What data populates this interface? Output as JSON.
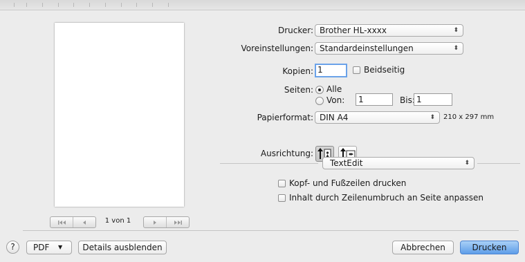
{
  "printer": {
    "label": "Drucker:",
    "value": "Brother HL-xxxx"
  },
  "presets": {
    "label": "Voreinstellungen:",
    "value": "Standardeinstellungen"
  },
  "copies": {
    "label": "Kopien:",
    "value": "1",
    "duplex_label": "Beidseitig",
    "duplex_checked": false
  },
  "pages": {
    "label": "Seiten:",
    "all_label": "Alle",
    "from_label": "Von:",
    "from_value": "1",
    "to_label": "Bis:",
    "to_value": "1",
    "selected": "all"
  },
  "paper": {
    "label": "Papierformat:",
    "value": "DIN A4",
    "size_text": "210 x 297 mm"
  },
  "orientation": {
    "label": "Ausrichtung:",
    "selected": "portrait",
    "options": [
      "portrait-icon",
      "landscape-icon"
    ]
  },
  "section_popup": {
    "value": "TextEdit"
  },
  "options": {
    "header_footer": {
      "label": "Kopf- und Fußzeilen drucken",
      "checked": false
    },
    "rewrap": {
      "label": "Inhalt durch Zeilenumbruch an Seite anpassen",
      "checked": false
    }
  },
  "preview": {
    "page_text": "1 von 1"
  },
  "footer": {
    "help_label": "?",
    "pdf_label": "PDF",
    "details_label": "Details ausblenden",
    "cancel_label": "Abbrechen",
    "print_label": "Drucken"
  },
  "colors": {
    "default_button": "#5d9de8",
    "focus_ring": "#6aa2e9",
    "background": "#ececec"
  }
}
